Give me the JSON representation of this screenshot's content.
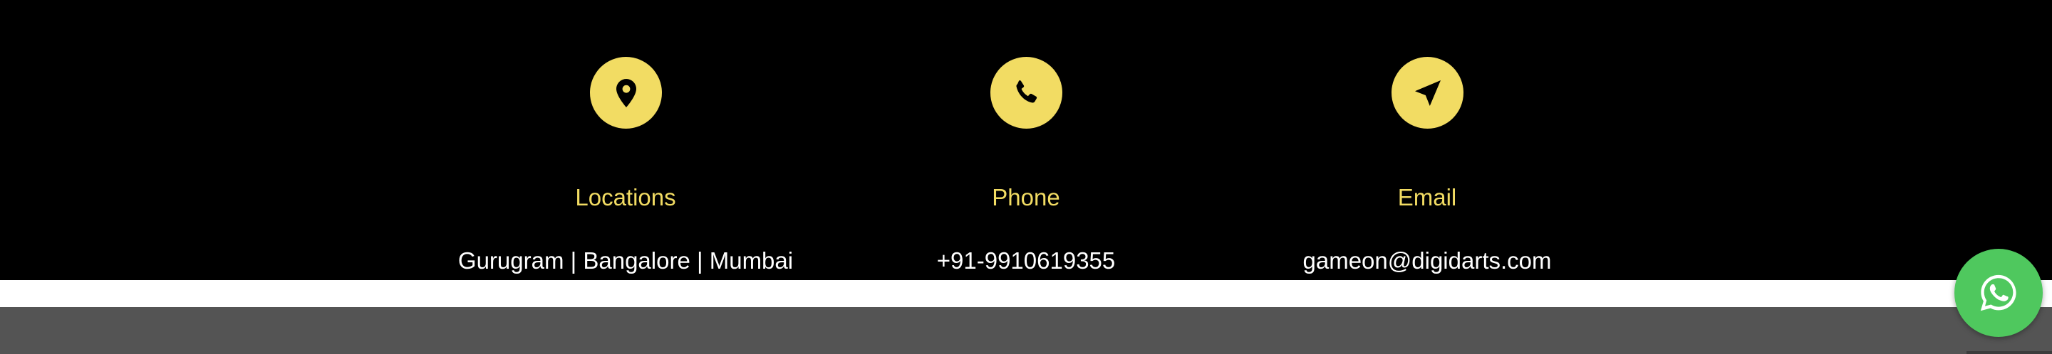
{
  "colors": {
    "accent": "#f2dc63",
    "band_background": "#000000",
    "text": "#ffffff",
    "gray_band": "#545454",
    "whatsapp": "#4fc85e"
  },
  "contacts": [
    {
      "icon": "location-pin-icon",
      "title": "Locations",
      "value": "Gurugram | Bangalore | Mumbai"
    },
    {
      "icon": "phone-icon",
      "title": "Phone",
      "value": "+91-9910619355"
    },
    {
      "icon": "send-arrow-icon",
      "title": "Email",
      "value": "gameon@digidarts.com"
    }
  ],
  "whatsapp": {
    "icon": "whatsapp-icon"
  }
}
